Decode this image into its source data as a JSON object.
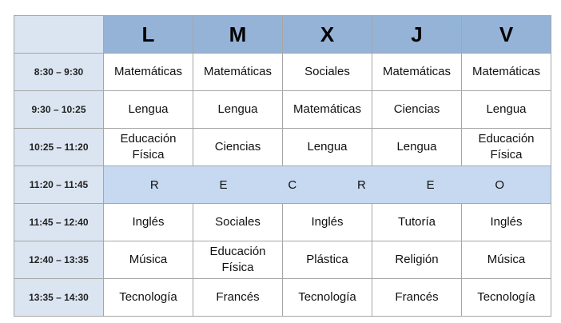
{
  "days": [
    "L",
    "M",
    "X",
    "J",
    "V"
  ],
  "rows": [
    {
      "time": "8:30 – 9:30",
      "subjects": [
        "Matemáticas",
        "Matemáticas",
        "Sociales",
        "Matemáticas",
        "Matemáticas"
      ]
    },
    {
      "time": "9:30 – 10:25",
      "subjects": [
        "Lengua",
        "Lengua",
        "Matemáticas",
        "Ciencias",
        "Lengua"
      ]
    },
    {
      "time": "10:25 – 11:20",
      "subjects": [
        "Educación Física",
        "Ciencias",
        "Lengua",
        "Lengua",
        "Educación Física"
      ]
    },
    {
      "time": "11:20 – 11:45",
      "recreo": [
        "R",
        "E",
        "C",
        "R",
        "E",
        "O"
      ]
    },
    {
      "time": "11:45 – 12:40",
      "subjects": [
        "Inglés",
        "Sociales",
        "Inglés",
        "Tutoría",
        "Inglés"
      ]
    },
    {
      "time": "12:40 – 13:35",
      "subjects": [
        "Música",
        "Educación Física",
        "Plástica",
        "Religión",
        "Música"
      ]
    },
    {
      "time": "13:35 – 14:30",
      "subjects": [
        "Tecnología",
        "Francés",
        "Tecnología",
        "Francés",
        "Tecnología"
      ]
    }
  ]
}
